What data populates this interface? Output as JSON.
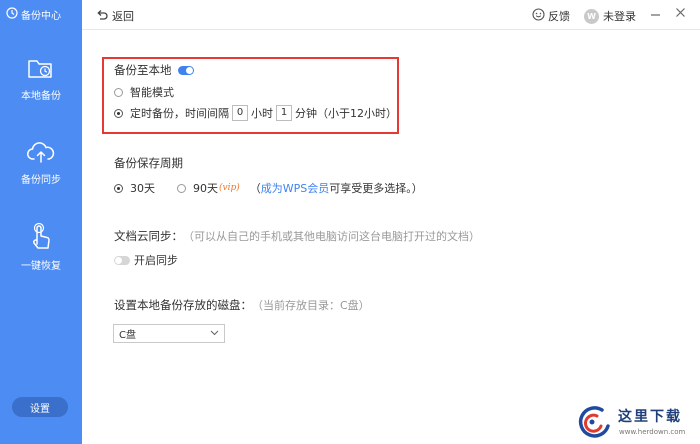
{
  "sidebar": {
    "brand": "备份中心",
    "items": [
      {
        "label": "本地备份",
        "icon": "folder-clock-icon"
      },
      {
        "label": "备份同步",
        "icon": "cloud-upload-icon"
      },
      {
        "label": "一键恢复",
        "icon": "hand-pointer-icon"
      }
    ],
    "settings_label": "设置"
  },
  "titlebar": {
    "back_label": "返回",
    "feedback_label": "反馈",
    "login_label": "未登录",
    "avatar_letter": "W"
  },
  "local_backup": {
    "title": "备份至本地",
    "toggle_on": true,
    "smart_mode_label": "智能模式",
    "scheduled_label": "定时备份，时间间隔",
    "hours_value": "0",
    "hours_unit": "小时",
    "minutes_value": "1",
    "minutes_unit": "分钟（小于12小时）"
  },
  "retention": {
    "title": "备份保存周期",
    "option_30": "30天",
    "option_90": "90天",
    "vip_tag": "(vip)",
    "paren_open": "（",
    "vip_link": "成为WPS会员",
    "vip_suffix": " 可享受更多选择。）"
  },
  "cloud_sync": {
    "title": "文档云同步：",
    "hint": "（可以从自己的手机或其他电脑访问这台电脑打开过的文档）",
    "enable_label": "开启同步",
    "toggle_on": false
  },
  "disk": {
    "title": "设置本地备份存放的磁盘：",
    "hint": "（当前存放目录：C盘）",
    "selected": "C盘"
  },
  "watermark": {
    "text": "这里下载",
    "url": "www.herdown.com"
  },
  "colors": {
    "sidebar": "#4d8cf3",
    "accent": "#3f83ee",
    "highlight": "#e53935",
    "vip": "#e8792b"
  }
}
